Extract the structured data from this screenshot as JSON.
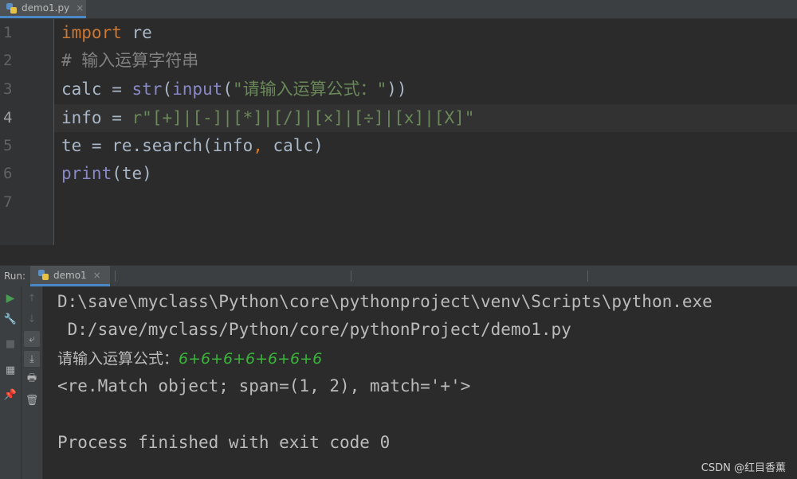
{
  "editor_tab": {
    "label": "demo1.py",
    "close": "×"
  },
  "editor": {
    "line_numbers": [
      "1",
      "2",
      "3",
      "4",
      "5",
      "6",
      "7"
    ],
    "line1": {
      "kw": "import",
      "rest": " re"
    },
    "line2": {
      "comment": "# 输入运算字符串"
    },
    "line3": {
      "a": "calc = ",
      "fn1": "str",
      "b": "(",
      "fn2": "input",
      "c": "(",
      "str": "\"请输入运算公式：\"",
      "d": "))"
    },
    "line4": {
      "a": "info = ",
      "str": "r\"[+]|[-]|[*]|[/]|[×]|[÷]|[x]|[X]\""
    },
    "line5": {
      "a": "te = re.search(info",
      "comma": ",",
      "b": " calc)"
    },
    "line6": {
      "fn": "print",
      "rest": "(te)"
    }
  },
  "run_panel": {
    "title": "Run:",
    "tab_label": "demo1",
    "tab_close": "×"
  },
  "console": {
    "line1": "D:\\save\\myclass\\Python\\core\\pythonproject\\venv\\Scripts\\python.exe",
    "line2": " D:/save/myclass/Python/core/pythonProject/demo1.py",
    "prompt": "请输入运算公式：",
    "user_input": "6+6+6+6+6+6+6",
    "result": "<re.Match object; span=(1, 2), match='+'>",
    "exit_message": "Process finished with exit code 0"
  },
  "watermark": "CSDN @红目香薰",
  "colors": {
    "keyword": "#cc7832",
    "string": "#6a8759",
    "builtin": "#8888c6",
    "comment": "#808080",
    "user_input": "#3bb33b"
  }
}
